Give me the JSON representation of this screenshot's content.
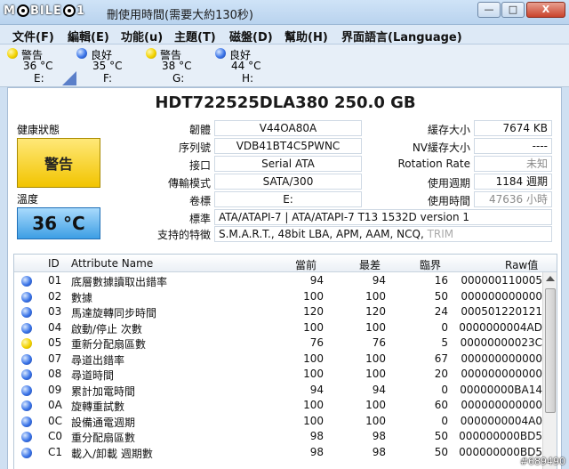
{
  "window": {
    "logo_left": "M",
    "logo_mid": "BILE",
    "logo_right": "1",
    "title": "刪使用時間(需要大約130秒)",
    "btn_min": "—",
    "btn_max": "□",
    "btn_close": "X"
  },
  "menu": [
    "文件(F)",
    "編輯(E)",
    "功能(u)",
    "主題(T)",
    "磁盤(D)",
    "幫助(H)",
    "界面語言(Language)"
  ],
  "drives": [
    {
      "status": "警告",
      "temp": "36 °C",
      "letter": "E:",
      "orb": "yellow"
    },
    {
      "status": "良好",
      "temp": "35 °C",
      "letter": "F:",
      "orb": "blue"
    },
    {
      "status": "警告",
      "temp": "38 °C",
      "letter": "G:",
      "orb": "yellow"
    },
    {
      "status": "良好",
      "temp": "44 °C",
      "letter": "H:",
      "orb": "blue"
    }
  ],
  "disk": {
    "model": "HDT722525DLA380  250.0 GB",
    "health_label": "健康狀態",
    "health_value": "警告",
    "temp_label": "溫度",
    "temp_value": "36 °C",
    "firmware_label": "韌體",
    "firmware": "V44OA80A",
    "serial_label": "序列號",
    "serial": "VDB41BT4C5PWNC",
    "interface_label": "接口",
    "interface": "Serial ATA",
    "transfer_label": "傳輸模式",
    "transfer": "SATA/300",
    "volume_label": "卷標",
    "volume": "E:",
    "standard_label": "標準",
    "standard": "ATA/ATAPI-7 | ATA/ATAPI-7 T13 1532D version 1",
    "features_label": "支持的特徵",
    "features": "S.M.A.R.T., 48bit LBA, APM, AAM, NCQ, ",
    "features_dim": "TRIM",
    "buffer_label": "緩存大小",
    "buffer": "7674 KB",
    "nvcache_label": "NV緩存大小",
    "nvcache": "----",
    "rotation_label": "Rotation Rate",
    "rotation": "未知",
    "powercount_label": "使用週期",
    "powercount": "1184 週期",
    "powerhours_label": "使用時間",
    "powerhours": "47636 小時"
  },
  "table": {
    "headers": [
      "ID",
      "Attribute Name",
      "當前",
      "最差",
      "臨界",
      "Raw值"
    ],
    "rows": [
      {
        "id": "01",
        "name": "底層數據讀取出錯率",
        "cur": "94",
        "worst": "94",
        "thr": "16",
        "raw": "000000110005",
        "orb": "blue"
      },
      {
        "id": "02",
        "name": "數據",
        "cur": "100",
        "worst": "100",
        "thr": "50",
        "raw": "000000000000",
        "orb": "blue"
      },
      {
        "id": "03",
        "name": "馬達旋轉同步時間",
        "cur": "120",
        "worst": "120",
        "thr": "24",
        "raw": "000501220121",
        "orb": "blue"
      },
      {
        "id": "04",
        "name": "啟動/停止 次數",
        "cur": "100",
        "worst": "100",
        "thr": "0",
        "raw": "0000000004AD",
        "orb": "blue"
      },
      {
        "id": "05",
        "name": "重新分配扇區數",
        "cur": "76",
        "worst": "76",
        "thr": "5",
        "raw": "00000000023C",
        "orb": "yellow"
      },
      {
        "id": "07",
        "name": "尋道出錯率",
        "cur": "100",
        "worst": "100",
        "thr": "67",
        "raw": "000000000000",
        "orb": "blue"
      },
      {
        "id": "08",
        "name": "尋道時間",
        "cur": "100",
        "worst": "100",
        "thr": "20",
        "raw": "000000000000",
        "orb": "blue"
      },
      {
        "id": "09",
        "name": "累計加電時間",
        "cur": "94",
        "worst": "94",
        "thr": "0",
        "raw": "00000000BA14",
        "orb": "blue"
      },
      {
        "id": "0A",
        "name": "旋轉重試數",
        "cur": "100",
        "worst": "100",
        "thr": "60",
        "raw": "000000000000",
        "orb": "blue"
      },
      {
        "id": "0C",
        "name": "設備通電週期",
        "cur": "100",
        "worst": "100",
        "thr": "0",
        "raw": "0000000004A0",
        "orb": "blue"
      },
      {
        "id": "C0",
        "name": "重分配扇區數",
        "cur": "98",
        "worst": "98",
        "thr": "50",
        "raw": "000000000BD5",
        "orb": "blue"
      },
      {
        "id": "C1",
        "name": "載入/卸載 週期數",
        "cur": "98",
        "worst": "98",
        "thr": "50",
        "raw": "000000000BD5",
        "orb": "blue"
      }
    ]
  },
  "stamp": "#689490",
  "colors": {
    "warning": "#f2c400",
    "good": "#3a74e8",
    "temp": "#3d9ee4"
  }
}
